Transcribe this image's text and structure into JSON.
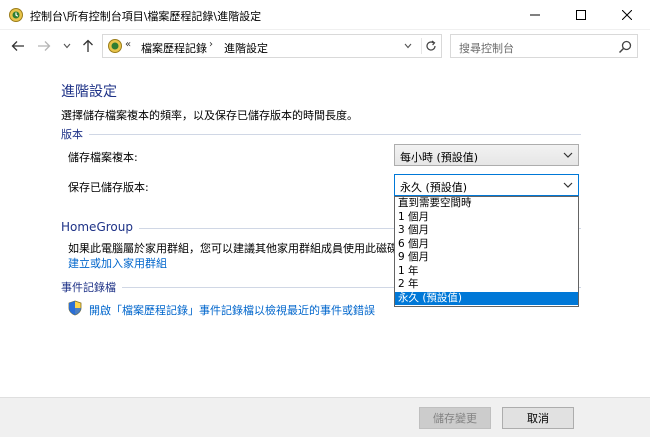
{
  "window": {
    "title": "控制台\\所有控制台項目\\檔案歷程記錄\\進階設定"
  },
  "address": {
    "chevron": "«",
    "crumbs": [
      "檔案歷程記錄",
      "進階設定"
    ],
    "separator": "›"
  },
  "search": {
    "placeholder": "搜尋控制台"
  },
  "page": {
    "title": "進階設定",
    "description": "選擇儲存檔案複本的頻率，以及保存已儲存版本的時間長度。"
  },
  "versions": {
    "section_label": "版本",
    "save_copies_label": "儲存檔案複本:",
    "save_copies_value": "每小時 (預設值)",
    "keep_versions_label": "保存已儲存版本:",
    "keep_versions_value": "永久 (預設值)",
    "keep_options": [
      "直到需要空間時",
      "1 個月",
      "3 個月",
      "6 個月",
      "9 個月",
      "1 年",
      "2 年",
      "永久 (預設值)"
    ],
    "selected_option": "永久 (預設值)"
  },
  "homegroup": {
    "section_label": "HomeGroup",
    "text": "如果此電腦屬於家用群組，您可以建議其他家用群組成員使用此磁碟",
    "link": "建立或加入家用群組"
  },
  "eventlog": {
    "section_label": "事件記錄檔",
    "link": "開啟「檔案歷程記錄」事件記錄檔以檢視最近的事件或錯誤"
  },
  "footer": {
    "save_label": "儲存變更",
    "cancel_label": "取消"
  },
  "colors": {
    "accent": "#0078d7",
    "heading": "#1e3287",
    "link": "#0066cc"
  }
}
